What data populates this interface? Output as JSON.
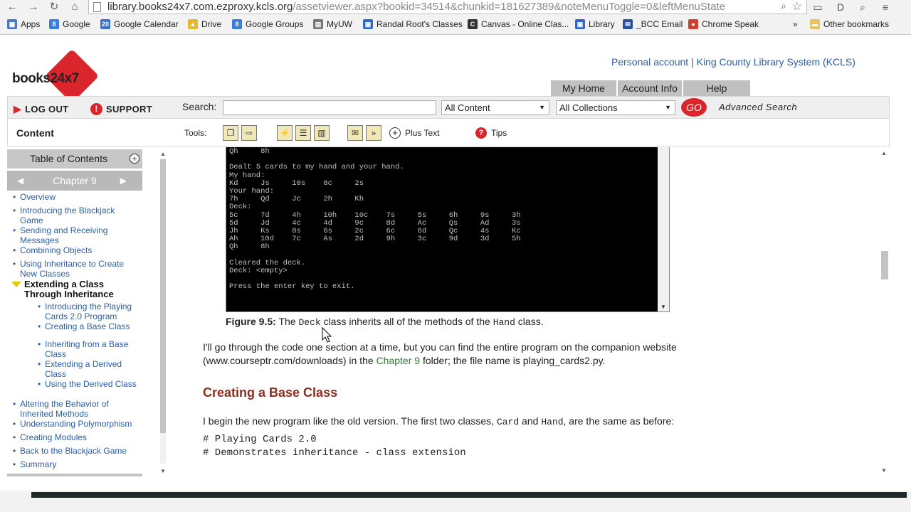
{
  "browser": {
    "url_main": "library.books24x7.com.ezproxy.kcls.org",
    "url_rest": "/assetviewer.aspx?bookid=34514&chunkid=181627389&noteMenuToggle=0&leftMenuState",
    "bookmarks": [
      "Apps",
      "Google",
      "Google Calendar",
      "Drive",
      "Google Groups",
      "MyUW",
      "Randal Root's Classes",
      "Canvas - Online Clas...",
      "Library",
      "_BCC Email",
      "Chrome Speak",
      "»",
      "Other bookmarks"
    ]
  },
  "header": {
    "logo": "books24x7",
    "account_link": "Personal account",
    "separator": "|",
    "library_link": "King County Library System (KCLS)",
    "tabs": [
      "My Home",
      "Account Info",
      "Help"
    ]
  },
  "search_bar": {
    "logout": "LOG OUT",
    "support": "SUPPORT",
    "search_label": "Search:",
    "content_select": "All Content",
    "collections_select": "All Collections",
    "go": "GO",
    "advanced": "Advanced Search"
  },
  "tools_bar": {
    "content_label": "Content",
    "tools_label": "Tools:",
    "plus_text": "Plus Text",
    "tips": "Tips"
  },
  "toc": {
    "heading": "Table of Contents",
    "chapter": "Chapter 9",
    "items": [
      "Overview",
      "Introducing the Blackjack Game",
      "Sending and Receiving Messages",
      "Combining Objects",
      "Using Inheritance to Create New Classes",
      "Extending a Class Through Inheritance",
      "Introducing the Playing Cards 2.0 Program",
      "Creating a Base Class",
      "Inheriting from a Base Class",
      "Extending a Derived Class",
      "Using the Derived Class",
      "Altering the Behavior of Inherited Methods",
      "Understanding Polymorphism",
      "Creating Modules",
      "Back to the Blackjack Game",
      "Summary"
    ]
  },
  "main": {
    "console_text": "Qh     8h\n\nDealt 5 cards to my hand and your hand.\nMy hand:\nKd     Js     10s    8c     2s\nYour hand:\n7h     Qd     Jc     2h     Kh\nDeck:\n5c     7d     4h     10h    10c    7s     5s     6h     9s     3h\n5d     Jd     4c     4d     9c     8d     Ac     Qs     Ad     3s\nJh     Ks     8s     6s     2c     6c     6d     Qc     4s     Kc\nAh     10d    7c     As     2d     9h     3c     9d     3d     5h\nQh     8h\n\nCleared the deck.\nDeck: <empty>\n\nPress the enter key to exit.",
    "caption_label": "Figure 9.5:",
    "caption_the": "The",
    "caption_deck": "Deck",
    "caption_mid": "class inherits all of the methods of the",
    "caption_hand": "Hand",
    "caption_end": "class.",
    "para1_a": "I'll go through the code one section at a time, but you can find the entire program on the companion website (www.courseptr.com/downloads) in the",
    "para1_link": "Chapter 9",
    "para1_b": "folder; the file name is playing_cards2.py.",
    "section_title": "Creating a Base Class",
    "para2_a": "I begin the new program like the old version. The first two classes,",
    "para2_card": "Card",
    "para2_and": "and",
    "para2_hand": "Hand",
    "para2_b": ", are the same as before:",
    "code_line1": "# Playing Cards 2.0",
    "code_line2": "# Demonstrates inheritance - class extension"
  }
}
